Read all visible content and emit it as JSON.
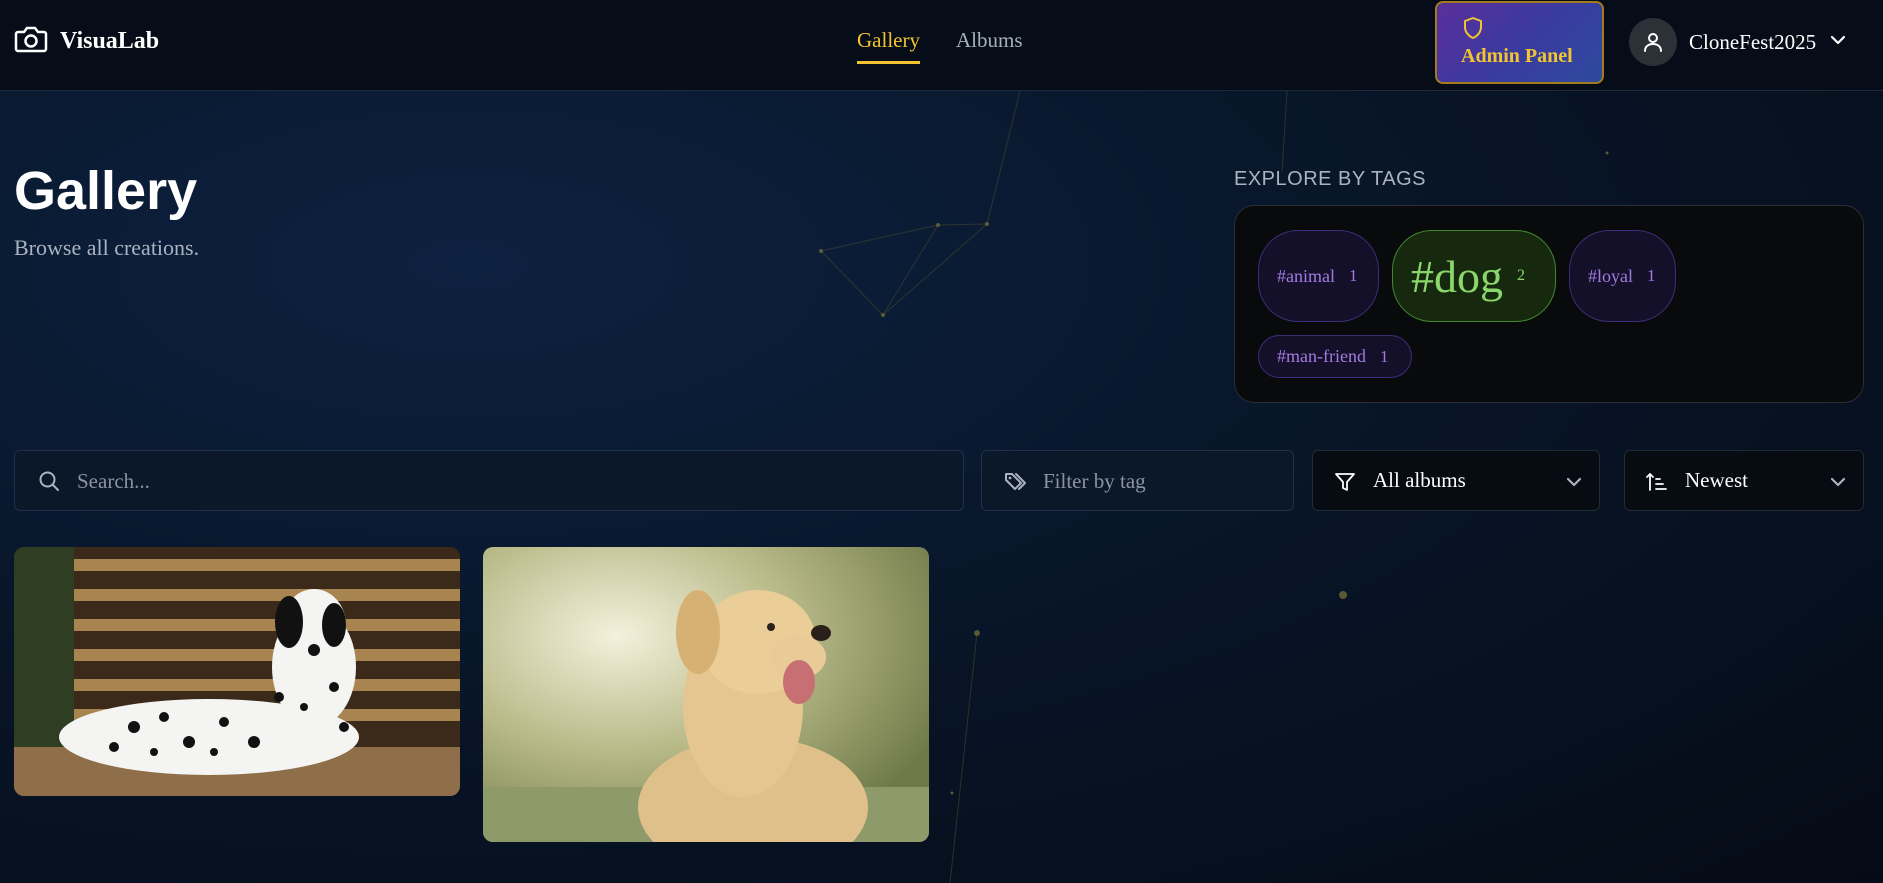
{
  "header": {
    "brand": "VisuaLab",
    "nav": [
      {
        "label": "Gallery",
        "active": true
      },
      {
        "label": "Albums",
        "active": false
      }
    ],
    "admin_label": "Admin Panel",
    "username": "CloneFest2025"
  },
  "page": {
    "title": "Gallery",
    "subtitle": "Browse all creations."
  },
  "tags": {
    "heading": "EXPLORE BY TAGS",
    "items": [
      {
        "name": "#animal",
        "count": "1"
      },
      {
        "name": "#dog",
        "count": "2"
      },
      {
        "name": "#loyal",
        "count": "1"
      },
      {
        "name": "#man-friend",
        "count": "1"
      }
    ]
  },
  "filters": {
    "search_placeholder": "Search...",
    "tag_placeholder": "Filter by tag",
    "album_value": "All albums",
    "sort_value": "Newest"
  },
  "images": [
    {
      "subject": "dalmatian-photo"
    },
    {
      "subject": "labrador-photo"
    }
  ],
  "colors": {
    "accent": "#f2c530",
    "tag_purple": "#a47ae0",
    "tag_green": "#8bd66a",
    "topbar": "#070d18"
  }
}
